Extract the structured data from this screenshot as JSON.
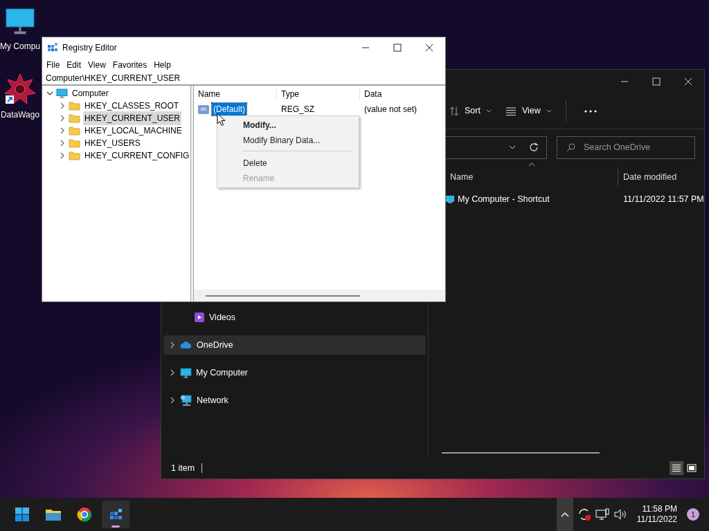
{
  "desktop_icons": [
    {
      "label": "My Compu",
      "kind": "monitor"
    },
    {
      "label": "DataWago",
      "kind": "shortcut"
    }
  ],
  "explorer": {
    "toolbar": [
      {
        "label": "Sort",
        "kind": "sort"
      },
      {
        "label": "View",
        "kind": "view"
      }
    ],
    "search": {
      "placeholder": "Search OneDrive"
    },
    "nav": [
      {
        "label": "Videos",
        "kind": "videos",
        "expandable": false,
        "selected": false
      },
      {
        "label": "OneDrive",
        "kind": "cloud",
        "expandable": true,
        "selected": true
      },
      {
        "label": "My Computer",
        "kind": "monitor",
        "expandable": true,
        "selected": false
      },
      {
        "label": "Network",
        "kind": "network",
        "expandable": true,
        "selected": false
      }
    ],
    "columns": [
      "Name",
      "Date modified"
    ],
    "files": [
      {
        "name": "My Computer - Shortcut",
        "date": "11/11/2022 11:57 PM"
      }
    ],
    "status": "1 item",
    "views": [
      {
        "kind": "details",
        "selected": true
      },
      {
        "kind": "tiles",
        "selected": false
      }
    ]
  },
  "regedit": {
    "title": "Registry Editor",
    "menu": [
      "File",
      "Edit",
      "View",
      "Favorites",
      "Help"
    ],
    "address": "Computer\\HKEY_CURRENT_USER",
    "tree": {
      "label": "Computer",
      "expanded": true,
      "children": [
        {
          "label": "HKEY_CLASSES_ROOT",
          "selected": false
        },
        {
          "label": "HKEY_CURRENT_USER",
          "selected": true
        },
        {
          "label": "HKEY_LOCAL_MACHINE",
          "selected": false
        },
        {
          "label": "HKEY_USERS",
          "selected": false
        },
        {
          "label": "HKEY_CURRENT_CONFIG",
          "selected": false
        }
      ]
    },
    "columns": [
      "Name",
      "Type",
      "Data"
    ],
    "values": [
      {
        "icon_text": "ab",
        "name": "(Default)",
        "type": "REG_SZ",
        "data": "(value not set)",
        "selected": true
      }
    ]
  },
  "context_menu": [
    {
      "kind": "item",
      "label": "Modify...",
      "default": true,
      "disabled": false
    },
    {
      "kind": "item",
      "label": "Modify Binary Data...",
      "default": false,
      "disabled": false
    },
    {
      "kind": "separator"
    },
    {
      "kind": "item",
      "label": "Delete",
      "default": false,
      "disabled": false
    },
    {
      "kind": "item",
      "label": "Rename",
      "default": false,
      "disabled": true
    }
  ],
  "taskbar": {
    "apps": [
      {
        "kind": "start",
        "active": false
      },
      {
        "kind": "folder",
        "active": false
      },
      {
        "kind": "browser",
        "active": false
      },
      {
        "kind": "registry",
        "active": true
      }
    ],
    "time": "11:58 PM",
    "date": "11/11/2022",
    "notifications": "1"
  }
}
